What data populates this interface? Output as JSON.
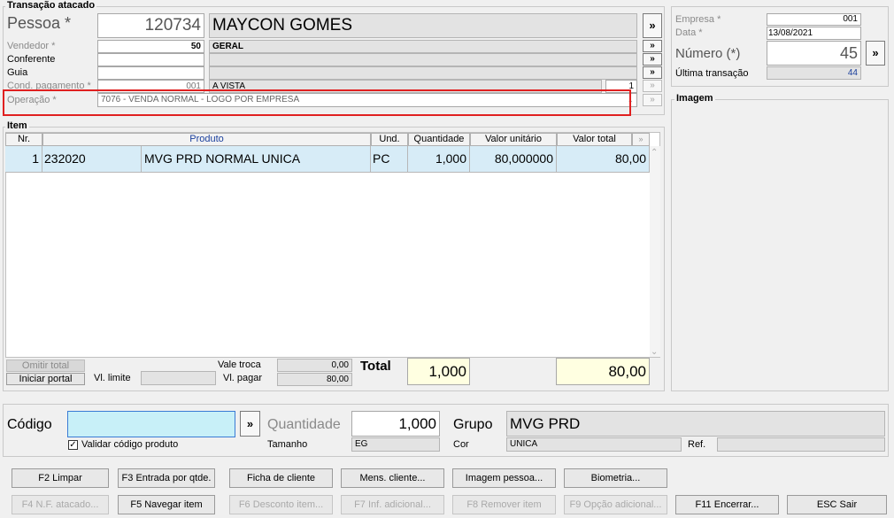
{
  "header": {
    "group_title": "Transação atacado"
  },
  "pessoa": {
    "label": "Pessoa *",
    "code": "120734",
    "name": "MAYCON GOMES"
  },
  "vendedor": {
    "label": "Vendedor *",
    "code": "50",
    "name": "GERAL"
  },
  "conferente": {
    "label": "Conferente",
    "code": "",
    "name": ""
  },
  "guia": {
    "label": "Guia",
    "code": "",
    "name": ""
  },
  "cond_pagamento": {
    "label": "Cond. pagamento *",
    "code": "001",
    "name": "A VISTA",
    "parcelas": "1"
  },
  "operacao": {
    "label": "Operação *",
    "value": "7076 - VENDA NORMAL - LOGO POR EMPRESA"
  },
  "arrow": "»",
  "mini_arrow": "»",
  "empresa": {
    "label": "Empresa *",
    "value": "001"
  },
  "data": {
    "label": "Data *",
    "value": "13/08/2021"
  },
  "numero": {
    "label": "Número (*)",
    "value": "45"
  },
  "ultima": {
    "label": "Última transação",
    "value": "44"
  },
  "imagem": {
    "title": "Imagem"
  },
  "item": {
    "title": "Item",
    "columns": [
      "Nr.",
      "Produto",
      "Und.",
      "Quantidade",
      "Valor unitário",
      "Valor total"
    ],
    "rows": [
      {
        "nr": "1",
        "codigo": "232020",
        "produto": "MVG PRD NORMAL UNICA",
        "und": "PC",
        "quantidade": "1,000",
        "valor_unitario": "80,000000",
        "valor_total": "80,00"
      }
    ]
  },
  "totals": {
    "omitir_total": "Omitir total",
    "iniciar_portal": "Iniciar portal",
    "vl_limite_label": "Vl. limite",
    "vl_limite_value": "",
    "vale_troca_label": "Vale troca",
    "vale_troca_value": "0,00",
    "vl_pagar_label": "Vl. pagar",
    "vl_pagar_value": "80,00",
    "total_label": "Total",
    "total_qtd": "1,000",
    "total_valor": "80,00"
  },
  "entry": {
    "codigo_label": "Código",
    "codigo_value": "",
    "validar_label": "Validar código produto",
    "quantidade_label": "Quantidade",
    "quantidade_value": "1,000",
    "tamanho_label": "Tamanho",
    "tamanho_value": "EG",
    "grupo_label": "Grupo",
    "grupo_value": "MVG PRD",
    "cor_label": "Cor",
    "cor_value": "UNICA",
    "ref_label": "Ref.",
    "ref_value": ""
  },
  "buttons_row1": [
    "F2 Limpar",
    "F3 Entrada por qtde.",
    "Ficha de cliente",
    "Mens. cliente...",
    "Imagem pessoa...",
    "Biometria..."
  ],
  "buttons_row2": [
    "F4 N.F. atacado...",
    "F5 Navegar item",
    "F6 Desconto item...",
    "F7 Inf. adicional...",
    "F8 Remover item",
    "F9 Opção adicional...",
    "F11 Encerrar...",
    "ESC Sair"
  ],
  "colors": {
    "highlight_border": "#e02020",
    "row_bg": "#d7ecf7",
    "total_bg": "#ffffe1",
    "codigo_bg": "#c8f0f8",
    "value_blue": "#1a3f9c"
  }
}
